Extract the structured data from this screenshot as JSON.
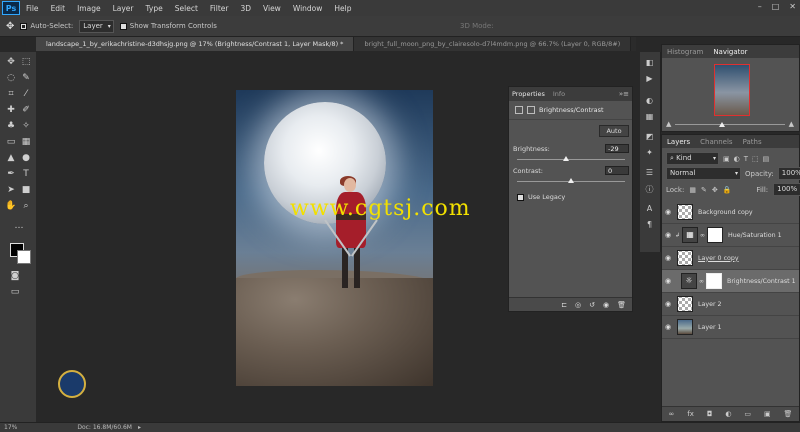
{
  "app": {
    "logo": "Ps"
  },
  "menu": [
    "File",
    "Edit",
    "Image",
    "Layer",
    "Type",
    "Select",
    "Filter",
    "3D",
    "View",
    "Window",
    "Help"
  ],
  "window_controls": [
    "–",
    "□",
    "✕"
  ],
  "options": {
    "auto_select_label": "Auto-Select:",
    "auto_select_value": "Layer",
    "transform_label": "Show Transform Controls",
    "mode_3d": "3D Mode:"
  },
  "tabs": [
    {
      "label": "landscape_1_by_erikachristine-d3dhsjg.png @ 17% (Brightness/Contrast 1, Layer Mask/8) *",
      "active": true
    },
    {
      "label": "bright_full_moon_png_by_clairesolo-d7l4mdm.png @ 66.7% (Layer 0, RGB/8#)",
      "active": false
    }
  ],
  "watermark": "www.cgtsj.com",
  "status": {
    "zoom": "17%",
    "doc": "Doc: 16.8M/60.6M"
  },
  "properties": {
    "tab_properties": "Properties",
    "tab_info": "Info",
    "title": "Brightness/Contrast",
    "auto": "Auto",
    "brightness_label": "Brightness:",
    "brightness_value": "-29",
    "contrast_label": "Contrast:",
    "contrast_value": "0",
    "use_legacy": "Use Legacy",
    "brightness_level": 0.45,
    "contrast_level": 0.5
  },
  "navigator": {
    "tab_histogram": "Histogram",
    "tab_navigator": "Navigator"
  },
  "layers_panel": {
    "tab_layers": "Layers",
    "tab_channels": "Channels",
    "tab_paths": "Paths",
    "kind": "Kind",
    "blend_mode": "Normal",
    "opacity_label": "Opacity:",
    "opacity_value": "100%",
    "lock_label": "Lock:",
    "fill_label": "Fill:",
    "fill_value": "100%",
    "layers": [
      {
        "name": "Background copy",
        "thumb": "chk-bg",
        "mask": false
      },
      {
        "name": "Hue/Saturation 1",
        "thumb": "adj",
        "mask": true
      },
      {
        "name": "Layer 0 copy",
        "thumb": "chk-bg",
        "mask": false
      },
      {
        "name": "Brightness/Contrast 1",
        "thumb": "adj",
        "mask": true,
        "selected": true
      },
      {
        "name": "Layer 2",
        "thumb": "chk-bg",
        "mask": false
      },
      {
        "name": "Layer 1",
        "thumb": "photo",
        "mask": false
      }
    ]
  }
}
